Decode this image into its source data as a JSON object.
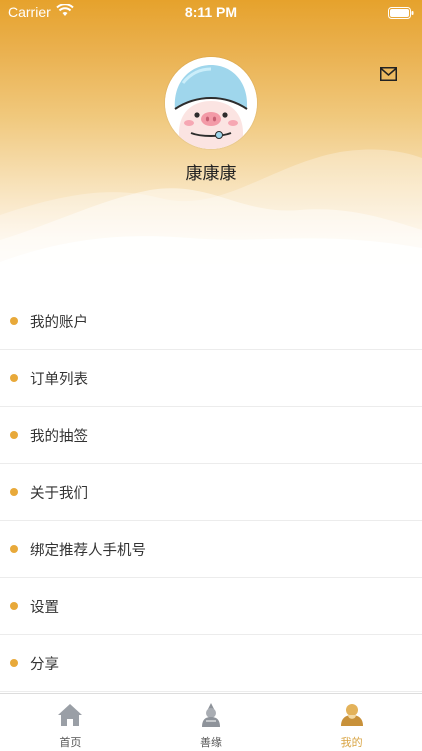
{
  "status_bar": {
    "carrier": "Carrier",
    "time": "8:11 PM",
    "wifi_icon": "wifi-icon",
    "battery_icon": "battery-icon"
  },
  "header": {
    "mail_icon": "mail-icon",
    "avatar_icon": "pig-avatar",
    "username": "康康康"
  },
  "menu": {
    "bullet_color": "#e8a93a",
    "items": [
      {
        "label": "我的账户"
      },
      {
        "label": "订单列表"
      },
      {
        "label": "我的抽签"
      },
      {
        "label": "关于我们"
      },
      {
        "label": "绑定推荐人手机号"
      },
      {
        "label": "设置"
      },
      {
        "label": "分享"
      }
    ]
  },
  "tabbar": {
    "active_color": "#d9a545",
    "inactive_color": "#555555",
    "tabs": [
      {
        "label": "首页",
        "icon": "home-icon",
        "active": false
      },
      {
        "label": "善缘",
        "icon": "monk-icon",
        "active": false
      },
      {
        "label": "我的",
        "icon": "profile-icon",
        "active": true
      }
    ]
  }
}
